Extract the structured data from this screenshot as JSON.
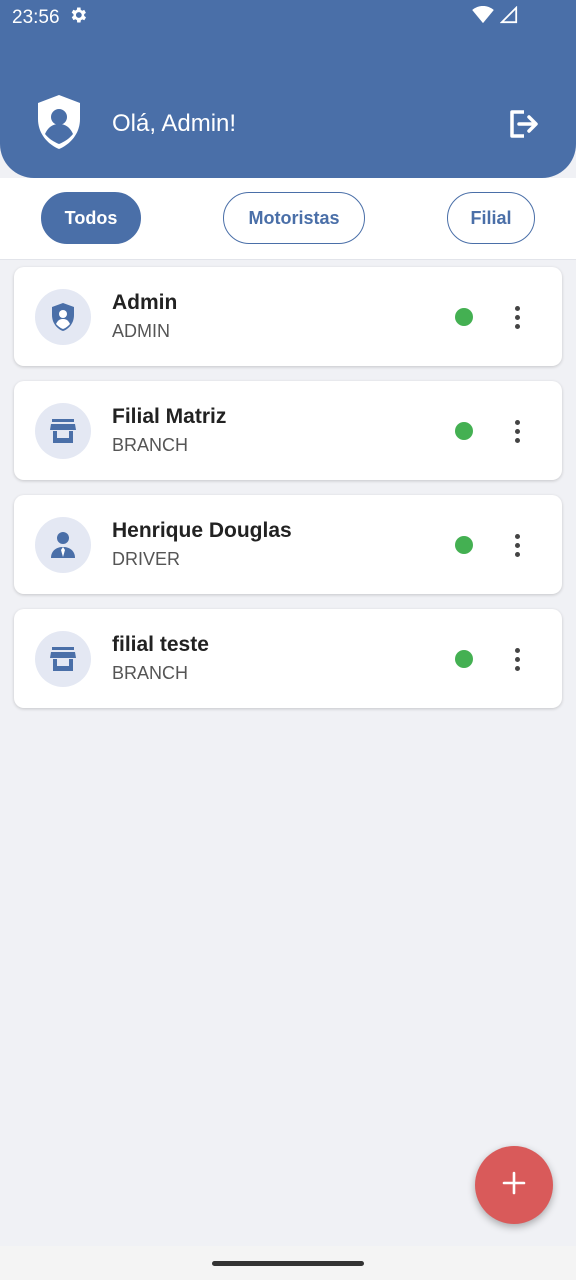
{
  "status_bar": {
    "time": "23:56",
    "icons": [
      "gear-icon",
      "wifi-icon",
      "signal-icon"
    ]
  },
  "header": {
    "greeting": "Olá, Admin!",
    "avatar_icon": "shield-user-icon",
    "logout_icon": "logout-icon",
    "background_color": "#4a6fa8"
  },
  "filters": {
    "items": [
      {
        "label": "Todos",
        "active": true
      },
      {
        "label": "Motoristas",
        "active": false
      },
      {
        "label": "Filial",
        "active": false
      }
    ]
  },
  "users": [
    {
      "name": "Admin",
      "role": "ADMIN",
      "icon": "shield-user-icon",
      "status_color": "#44b052"
    },
    {
      "name": "Filial Matriz",
      "role": "BRANCH",
      "icon": "store-icon",
      "status_color": "#44b052"
    },
    {
      "name": "Henrique Douglas",
      "role": "DRIVER",
      "icon": "person-tie-icon",
      "status_color": "#44b052"
    },
    {
      "name": "filial teste",
      "role": "BRANCH",
      "icon": "store-icon",
      "status_color": "#44b052"
    }
  ],
  "fab": {
    "icon": "plus-icon",
    "color": "#d95a5a"
  }
}
